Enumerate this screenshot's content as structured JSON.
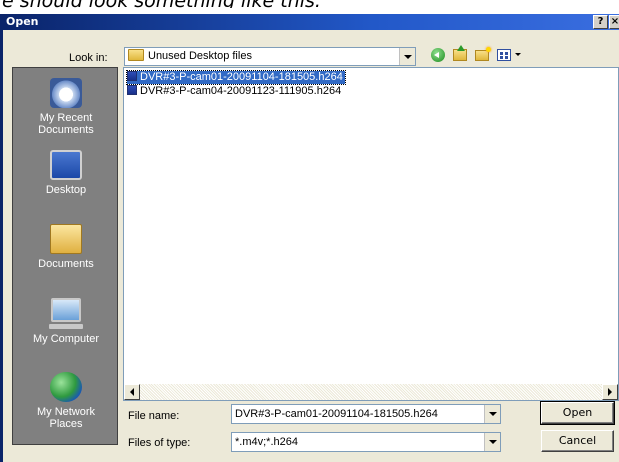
{
  "caption": "e should look something like this.",
  "window": {
    "title": "Open",
    "help_button": "?",
    "close_button": "×"
  },
  "look_in": {
    "label": "Look in:",
    "value": "Unused Desktop files"
  },
  "toolbar": [
    "back-icon",
    "up-folder-icon",
    "new-folder-icon",
    "views-menu-icon"
  ],
  "places": [
    {
      "label": "My Recent Documents",
      "icon": "recent-documents-icon"
    },
    {
      "label": "Desktop",
      "icon": "desktop-icon"
    },
    {
      "label": "Documents",
      "icon": "documents-folder-icon"
    },
    {
      "label": "My Computer",
      "icon": "my-computer-icon"
    },
    {
      "label": "My Network Places",
      "icon": "network-places-icon"
    }
  ],
  "files": [
    {
      "name": "DVR#3-P-cam01-20091104-181505.h264",
      "selected": true
    },
    {
      "name": "DVR#3-P-cam04-20091123-111905.h264",
      "selected": false
    }
  ],
  "file_name": {
    "label": "File name:",
    "value": "DVR#3-P-cam01-20091104-181505.h264"
  },
  "file_type": {
    "label": "Files of type:",
    "value": "*.m4v;*.h264"
  },
  "buttons": {
    "open": "Open",
    "cancel": "Cancel"
  },
  "colors": {
    "title_bar": "#0a246a",
    "selection": "#316ac5",
    "places_bar": "#808080",
    "dialog_face": "#ece9d8"
  }
}
